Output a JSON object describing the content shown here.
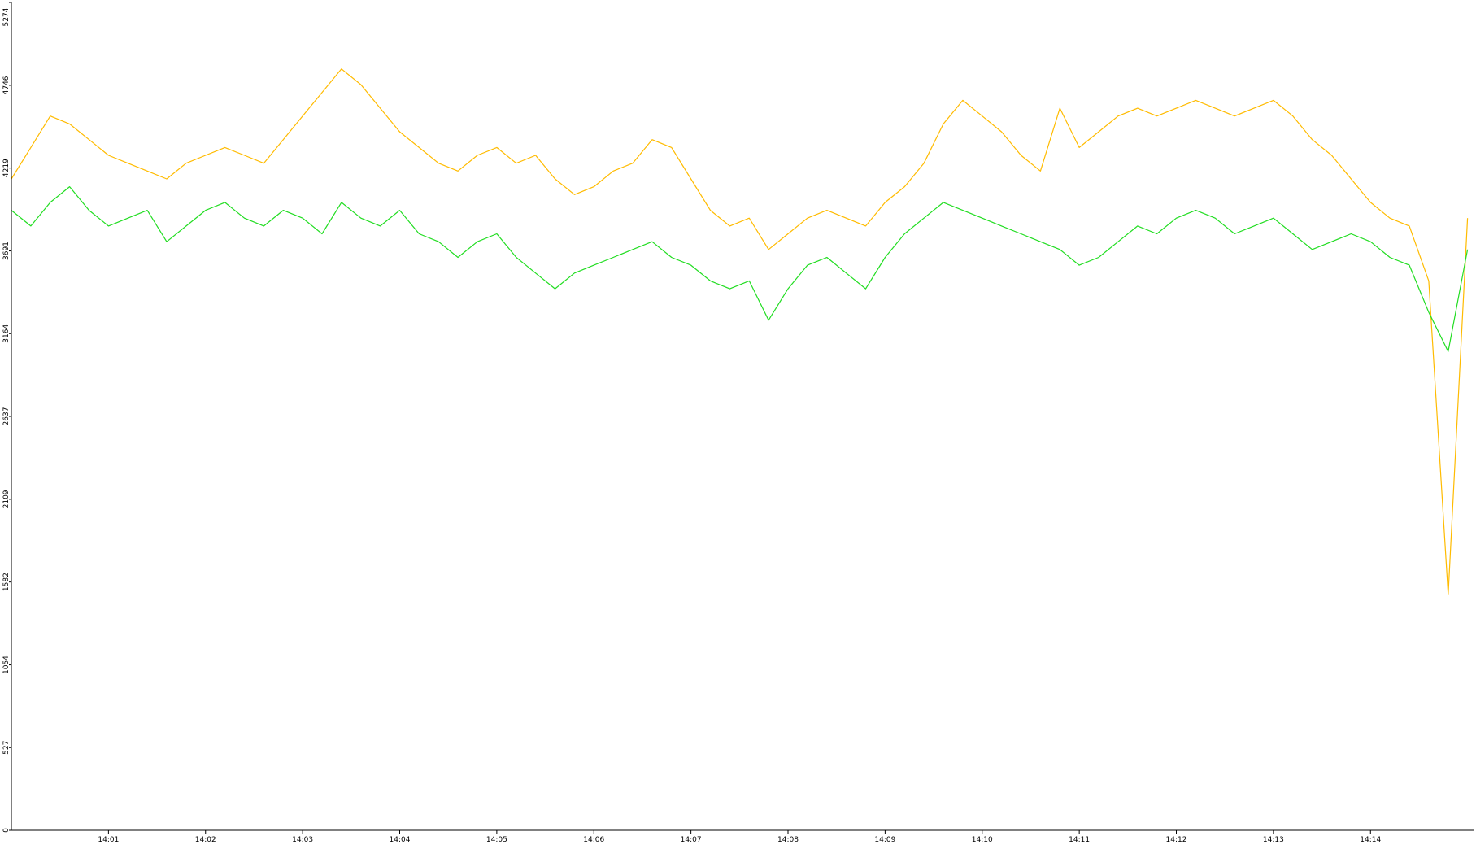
{
  "chart_data": {
    "type": "line",
    "title": "",
    "xlabel": "",
    "ylabel": "",
    "ylim": [
      0,
      5274
    ],
    "xlim": [
      0,
      15.07
    ],
    "y_ticks": [
      {
        "value": 0,
        "label": "0"
      },
      {
        "value": 527,
        "label": "527"
      },
      {
        "value": 1054,
        "label": "1054"
      },
      {
        "value": 1582,
        "label": "1582"
      },
      {
        "value": 2109,
        "label": "2109"
      },
      {
        "value": 2637,
        "label": "2637"
      },
      {
        "value": 3164,
        "label": "3164"
      },
      {
        "value": 3691,
        "label": "3691"
      },
      {
        "value": 4219,
        "label": "4219"
      },
      {
        "value": 4746,
        "label": "4746"
      },
      {
        "value": 5274,
        "label": "5274"
      }
    ],
    "x_ticks": [
      {
        "value": 1,
        "label": "14:01"
      },
      {
        "value": 2,
        "label": "14:02"
      },
      {
        "value": 3,
        "label": "14:03"
      },
      {
        "value": 4,
        "label": "14:04"
      },
      {
        "value": 5,
        "label": "14:05"
      },
      {
        "value": 6,
        "label": "14:06"
      },
      {
        "value": 7,
        "label": "14:07"
      },
      {
        "value": 8,
        "label": "14:08"
      },
      {
        "value": 9,
        "label": "14:09"
      },
      {
        "value": 10,
        "label": "14:10"
      },
      {
        "value": 11,
        "label": "14:11"
      },
      {
        "value": 12,
        "label": "14:12"
      },
      {
        "value": 13,
        "label": "14:13"
      },
      {
        "value": 14,
        "label": "14:14"
      }
    ],
    "grid": false,
    "legend": "none",
    "series": [
      {
        "color": "#ffbb00",
        "x": [
          0.0,
          0.2,
          0.4,
          0.6,
          0.8,
          1.0,
          1.2,
          1.4,
          1.6,
          1.8,
          2.0,
          2.2,
          2.4,
          2.6,
          2.8,
          3.0,
          3.2,
          3.4,
          3.6,
          3.8,
          4.0,
          4.2,
          4.4,
          4.6,
          4.8,
          5.0,
          5.2,
          5.4,
          5.6,
          5.8,
          6.0,
          6.2,
          6.4,
          6.6,
          6.8,
          7.0,
          7.2,
          7.4,
          7.6,
          7.8,
          8.0,
          8.2,
          8.4,
          8.6,
          8.8,
          9.0,
          9.2,
          9.4,
          9.6,
          9.8,
          10.0,
          10.2,
          10.4,
          10.6,
          10.8,
          11.0,
          11.2,
          11.4,
          11.6,
          11.8,
          12.0,
          12.2,
          12.4,
          12.6,
          12.8,
          13.0,
          13.2,
          13.4,
          13.6,
          13.8,
          14.0,
          14.2,
          14.4,
          14.6,
          14.8,
          15.0
        ],
        "y": [
          4150,
          4350,
          4550,
          4500,
          4400,
          4300,
          4250,
          4200,
          4150,
          4250,
          4300,
          4350,
          4300,
          4250,
          4400,
          4550,
          4700,
          4850,
          4750,
          4600,
          4450,
          4350,
          4250,
          4200,
          4300,
          4350,
          4250,
          4300,
          4150,
          4050,
          4100,
          4200,
          4250,
          4400,
          4350,
          4150,
          3950,
          3850,
          3900,
          3700,
          3800,
          3900,
          3950,
          3900,
          3850,
          4000,
          4100,
          4250,
          4500,
          4650,
          4550,
          4450,
          4300,
          4200,
          4600,
          4350,
          4450,
          4550,
          4600,
          4550,
          4600,
          4650,
          4600,
          4550,
          4600,
          4650,
          4550,
          4400,
          4300,
          4150,
          4000,
          3900,
          3850,
          3500,
          1500,
          3900
        ]
      },
      {
        "color": "#22dd22",
        "x": [
          0.0,
          0.2,
          0.4,
          0.6,
          0.8,
          1.0,
          1.2,
          1.4,
          1.6,
          1.8,
          2.0,
          2.2,
          2.4,
          2.6,
          2.8,
          3.0,
          3.2,
          3.4,
          3.6,
          3.8,
          4.0,
          4.2,
          4.4,
          4.6,
          4.8,
          5.0,
          5.2,
          5.4,
          5.6,
          5.8,
          6.0,
          6.2,
          6.4,
          6.6,
          6.8,
          7.0,
          7.2,
          7.4,
          7.6,
          7.8,
          8.0,
          8.2,
          8.4,
          8.6,
          8.8,
          9.0,
          9.2,
          9.4,
          9.6,
          9.8,
          10.0,
          10.2,
          10.4,
          10.6,
          10.8,
          11.0,
          11.2,
          11.4,
          11.6,
          11.8,
          12.0,
          12.2,
          12.4,
          12.6,
          12.8,
          13.0,
          13.2,
          13.4,
          13.6,
          13.8,
          14.0,
          14.2,
          14.4,
          14.6,
          14.8,
          15.0
        ],
        "y": [
          3950,
          3850,
          4000,
          4100,
          3950,
          3850,
          3900,
          3950,
          3750,
          3850,
          3950,
          4000,
          3900,
          3850,
          3950,
          3900,
          3800,
          4000,
          3900,
          3850,
          3950,
          3800,
          3750,
          3650,
          3750,
          3800,
          3650,
          3550,
          3450,
          3550,
          3600,
          3650,
          3700,
          3750,
          3650,
          3600,
          3500,
          3450,
          3500,
          3250,
          3450,
          3600,
          3650,
          3550,
          3450,
          3650,
          3800,
          3900,
          4000,
          3950,
          3900,
          3850,
          3800,
          3750,
          3700,
          3600,
          3650,
          3750,
          3850,
          3800,
          3900,
          3950,
          3900,
          3800,
          3850,
          3900,
          3800,
          3700,
          3750,
          3800,
          3750,
          3650,
          3600,
          3300,
          3050,
          3700
        ]
      }
    ]
  }
}
